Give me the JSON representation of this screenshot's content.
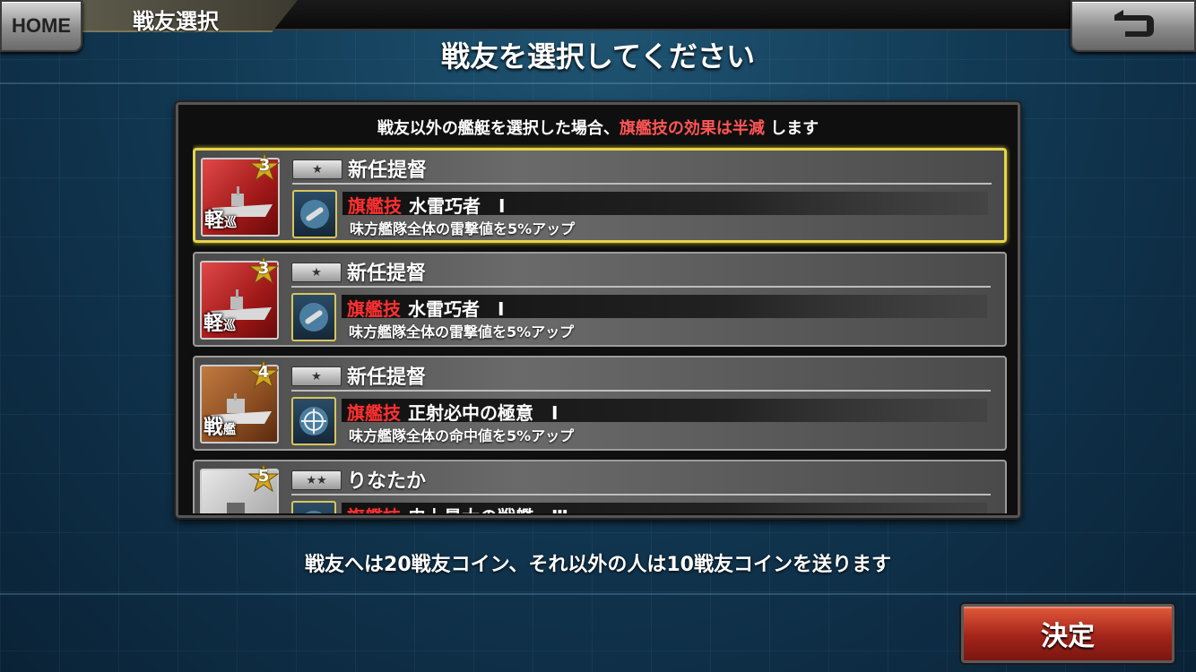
{
  "header": {
    "home_label": "HOME",
    "title": "戦友選択",
    "back_icon": "back-arrow-icon"
  },
  "heading": "戦友を選択してください",
  "panel": {
    "notice_prefix": "戦友以外の艦艇を選択した場合、",
    "notice_highlight": "旗艦技の効果は半減",
    "notice_suffix": "します"
  },
  "friends": [
    {
      "ship_type": "軽",
      "ship_type_small": "巡",
      "stars": "3",
      "rank_icon": "one-star-rank-icon",
      "name": "新任提督",
      "skill_label": "旗艦技",
      "skill_name": "水雷巧者　Ⅰ",
      "skill_desc": "味方艦隊全体の雷撃値を5%アップ",
      "selected": true
    },
    {
      "ship_type": "軽",
      "ship_type_small": "巡",
      "stars": "3",
      "rank_icon": "one-star-rank-icon",
      "name": "新任提督",
      "skill_label": "旗艦技",
      "skill_name": "水雷巧者　Ⅰ",
      "skill_desc": "味方艦隊全体の雷撃値を5%アップ",
      "selected": false
    },
    {
      "ship_type": "戦",
      "ship_type_small": "艦",
      "stars": "4",
      "rank_icon": "one-star-rank-icon",
      "name": "新任提督",
      "skill_label": "旗艦技",
      "skill_name": "正射必中の極意　Ⅰ",
      "skill_desc": "味方艦隊全体の命中値を5%アップ",
      "selected": false
    },
    {
      "ship_type": "",
      "ship_type_small": "",
      "stars": "5",
      "rank_icon": "two-star-rank-icon",
      "name": "りなたか",
      "skill_label": "旗艦技",
      "skill_name": "史上最大の戦艦　Ⅲ",
      "skill_desc": "",
      "selected": false
    }
  ],
  "footer_text": "戦友へは20戦友コイン、それ以外の人は10戦友コインを送ります",
  "decide_label": "決定",
  "colors": {
    "accent_red": "#ff3030",
    "selected_border": "#e6d44a"
  }
}
